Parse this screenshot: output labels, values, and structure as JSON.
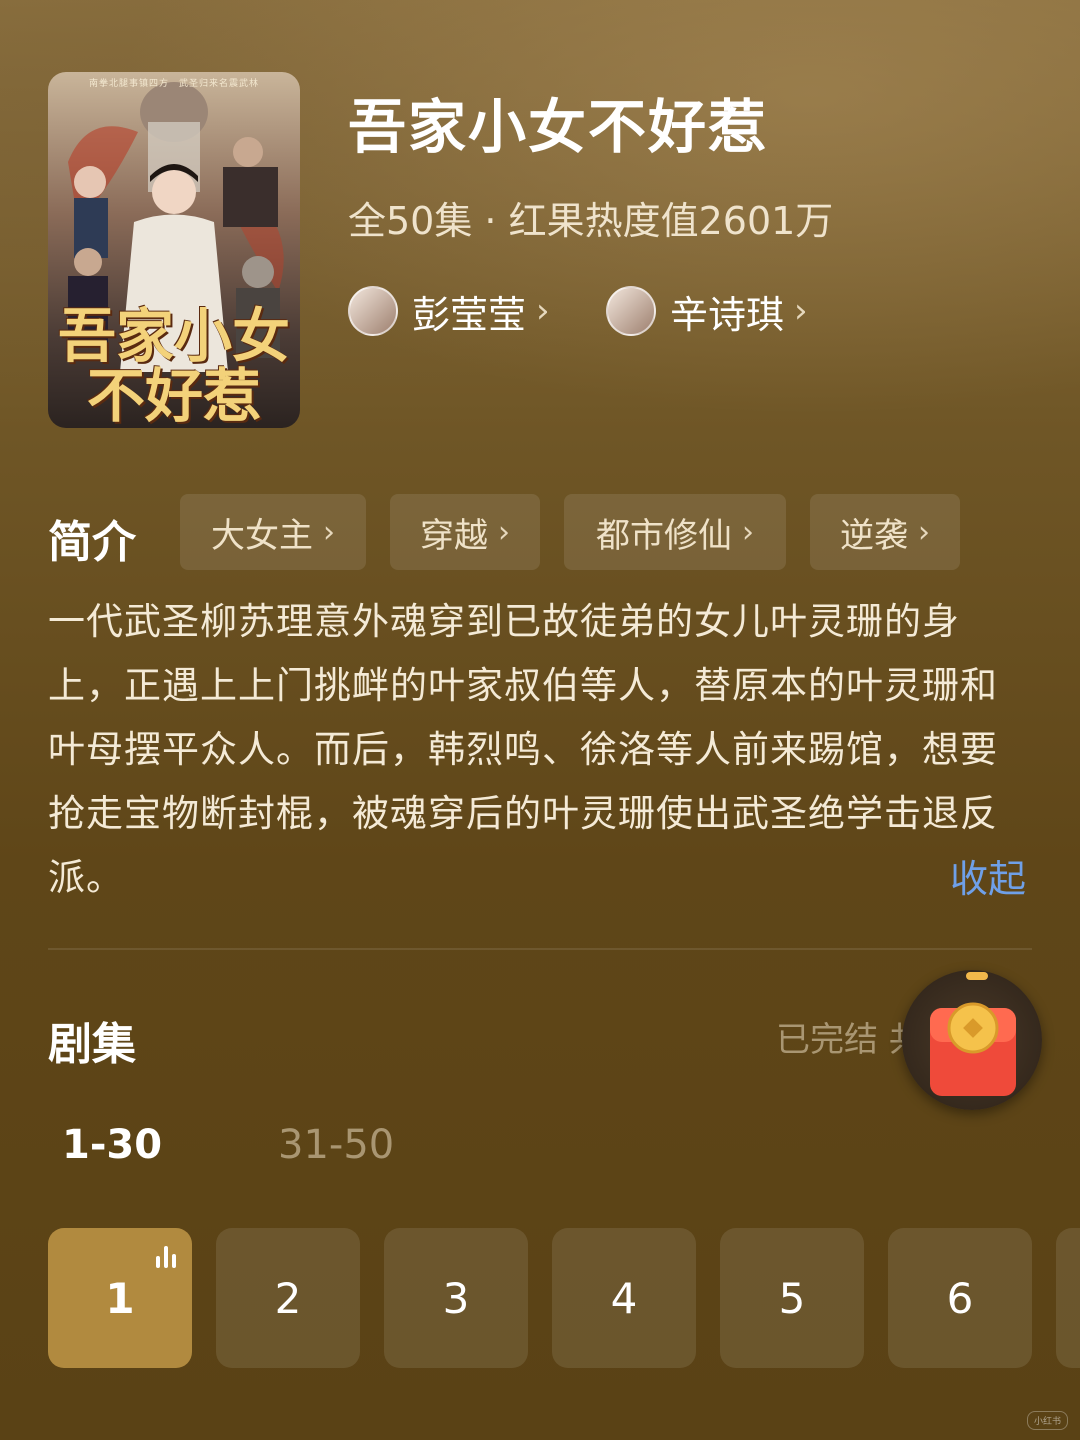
{
  "drama": {
    "title": "吾家小女不好惹",
    "meta": "全50集 · 红果热度值2601万",
    "poster": {
      "title_line1": "吾家小女",
      "title_line2": "不好惹",
      "tagline": "南拳北腿事镇四方　武圣归来名震武林"
    },
    "actors": [
      {
        "name": "彭莹莹"
      },
      {
        "name": "辛诗琪"
      }
    ]
  },
  "synopsis": {
    "heading": "简介",
    "tags": [
      "大女主",
      "穿越",
      "都市修仙",
      "逆袭"
    ],
    "text": "一代武圣柳苏理意外魂穿到已故徒弟的女儿叶灵珊的身上，正遇上上门挑衅的叶家叔伯等人，替原本的叶灵珊和叶母摆平众人。而后，韩烈鸣、徐洛等人前来踢馆，想要抢走宝物断封棍，被魂穿后的叶灵珊使出武圣绝学击退反派。",
    "collapse_label": "收起"
  },
  "episodes": {
    "heading": "剧集",
    "status": "已完结 共",
    "ranges": [
      "1-30",
      "31-50"
    ],
    "active_range": "1-30",
    "visible": [
      "1",
      "2",
      "3",
      "4",
      "5",
      "6"
    ],
    "current": "1"
  },
  "watermark": "小红书",
  "icons": {
    "chevron": "chevron-right-icon",
    "playing": "sound-wave-icon",
    "red_packet": "red-envelope-coin-icon"
  },
  "colors": {
    "active_episode": "#b18a3f",
    "link": "#6fa0e8",
    "background": "#5f4618"
  }
}
